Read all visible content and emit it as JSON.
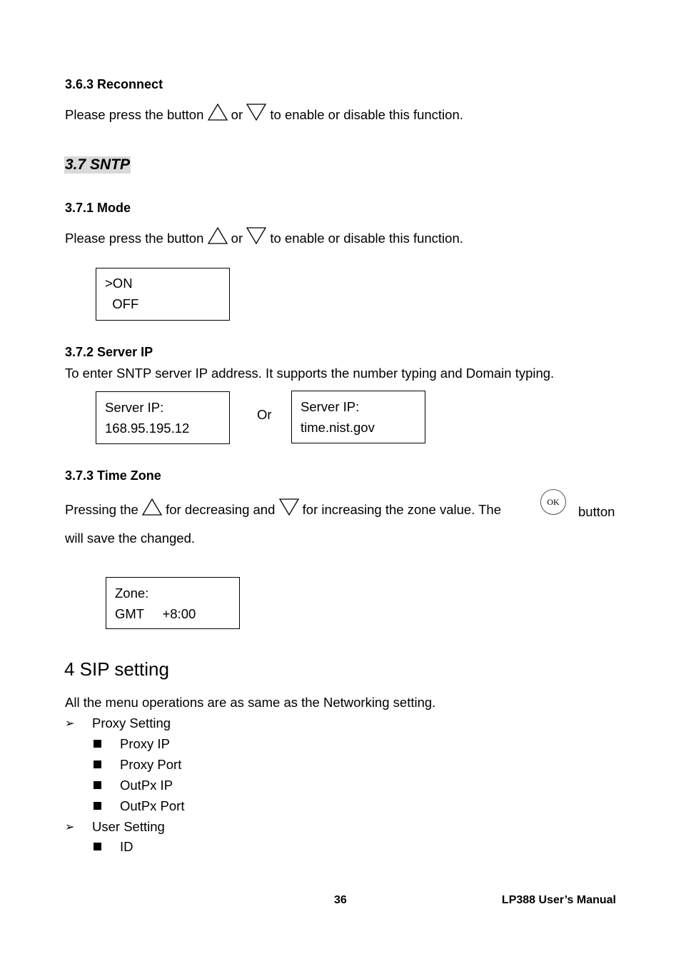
{
  "section_363": {
    "heading": "3.6.3 Reconnect",
    "text_before": "Please press the button",
    "text_or": "or",
    "text_after": "to enable or disable this function."
  },
  "section_37": {
    "heading": "3.7 SNTP"
  },
  "section_371": {
    "heading": "3.7.1 Mode",
    "text_before": "Please press the button",
    "text_or": "or",
    "text_after": "to enable or disable this function.",
    "display": {
      "line1": ">ON",
      "line2": "  OFF"
    }
  },
  "section_372": {
    "heading": "3.7.2 Server IP",
    "text": "To enter SNTP server IP address. It supports the number typing and Domain typing.",
    "display_a": {
      "line1": "Server IP:",
      "line2": "168.95.195.12"
    },
    "or_label": "Or",
    "display_b": {
      "line1": "Server IP:",
      "line2": "time.nist.gov"
    }
  },
  "section_373": {
    "heading": "3.7.3 Time Zone",
    "text_1": "Pressing the",
    "text_2": "for decreasing and",
    "text_3": "for increasing the zone value. The",
    "ok_label": "OK",
    "text_4": "button",
    "text_5": "will save the changed.",
    "display": {
      "line1": "Zone:",
      "line2": "GMT     +8:00"
    }
  },
  "section_4": {
    "heading": "4  SIP setting",
    "intro": "All the menu operations are as same as the Networking setting.",
    "groups": [
      {
        "label": "Proxy Setting",
        "items": [
          "Proxy IP",
          "Proxy Port",
          "OutPx IP",
          "OutPx Port"
        ]
      },
      {
        "label": "User Setting",
        "items": [
          "ID"
        ]
      }
    ]
  },
  "footer": {
    "page_number": "36",
    "manual_title": "LP388  User’s  Manual"
  }
}
